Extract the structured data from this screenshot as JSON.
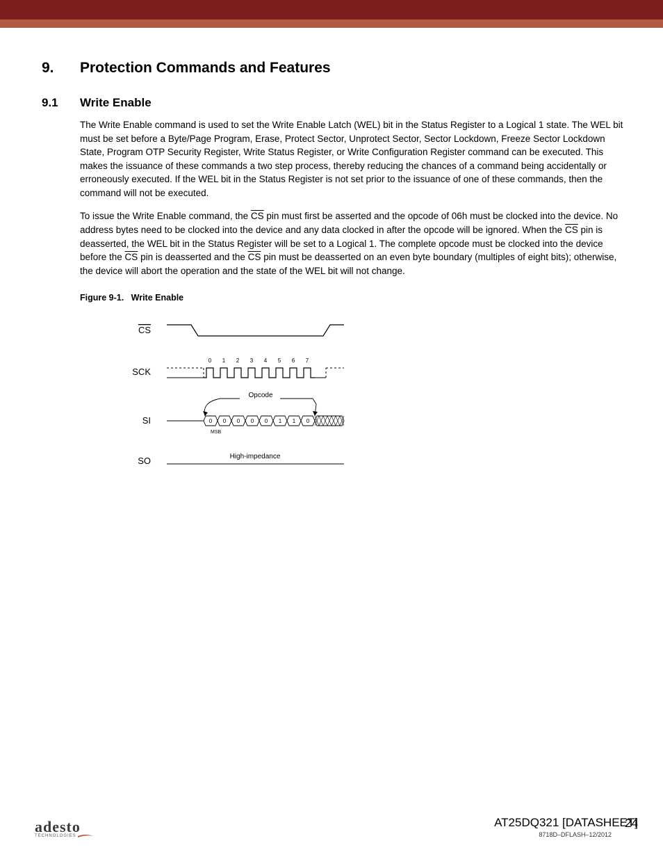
{
  "section": {
    "number": "9.",
    "title": "Protection Commands and Features"
  },
  "subsection": {
    "number": "9.1",
    "title": "Write Enable"
  },
  "paragraphs": {
    "p1a": "The Write Enable command is used to set the Write Enable Latch (WEL) bit in the Status Register to a Logical 1 state. The WEL bit must be set before a Byte/Page Program, Erase, Protect Sector, Unprotect Sector, Sector Lockdown, Freeze Sector Lockdown State, Program OTP Security Register, Write Status Register, or Write Configuration Register command can be executed. This makes the issuance of these commands a two step process, thereby reducing the chances of a command being accidentally or erroneously executed. If the WEL bit in the Status Register is not set prior to the issuance of one of these commands, then the command will not be executed.",
    "p2_seg1": "To issue the Write Enable command, the ",
    "p2_seg2": " pin must first be asserted and the opcode of 06h must be clocked into the device. No address bytes need to be clocked into the device and any data clocked in after the opcode will be ignored. When the ",
    "p2_seg3": " pin is deasserted, the WEL bit in the Status Register will be set to a Logical 1. The complete opcode must be clocked into the device before the ",
    "p2_seg4": " pin is deasserted and the ",
    "p2_seg5": " pin must be deasserted on an even byte boundary (multiples of eight bits); otherwise, the device will abort the operation and the state of the WEL bit will not change.",
    "cs": "CS"
  },
  "figure": {
    "caption_prefix": "Figure 9-1.",
    "caption_title": "Write Enable",
    "signals": {
      "cs": "CS",
      "sck": "SCK",
      "si": "SI",
      "so": "SO"
    },
    "clock_labels": [
      "0",
      "1",
      "2",
      "3",
      "4",
      "5",
      "6",
      "7"
    ],
    "opcode_label": "Opcode",
    "opcode_bits": [
      "0",
      "0",
      "0",
      "0",
      "0",
      "1",
      "1",
      "0"
    ],
    "msb_label": "MSB",
    "hiz_label": "High-impedance"
  },
  "footer": {
    "logo_main": "adesto",
    "logo_sub": "TECHNOLOGIES",
    "doc_title": "AT25DQ321 [DATASHEET]",
    "doc_code": "8718D–DFLASH–12/2012",
    "page": "24"
  }
}
